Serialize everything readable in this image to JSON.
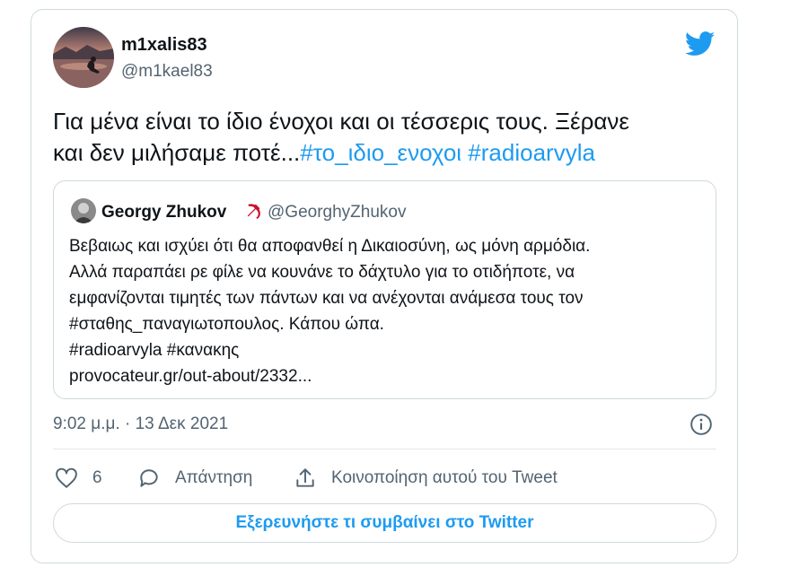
{
  "author": {
    "display_name": "m1xalis83",
    "handle": "@m1kael83"
  },
  "tweet": {
    "text_line1": "Για μένα είναι το ίδιο ένοχοι και οι τέσσερις τους. Ξέρανε",
    "text_line2_plain": "και δεν μιλήσαμε ποτέ...",
    "hashtag_1": "#το_ιδιο_ενοχοι",
    "hashtag_2": "#radioarvyla"
  },
  "quoted_tweet": {
    "display_name": "Georgy Zhukov",
    "handle": "@GeorghyZhukov",
    "lines": [
      "Βεβαιως και ισχύει ότι θα αποφανθεί η Δικαιοσύνη, ως μόνη αρμόδια.",
      "Αλλά παραπάει ρε φίλε να κουνάνε το δάχτυλο για το οτιδήποτε, να",
      "εμφανίζονται τιμητές των πάντων και να ανέχονται ανάμεσα τους τον",
      "#σταθης_παναγιωτοπουλος. Κάπου ώπα.",
      "#radioarvyla #κανακης",
      "provocateur.gr/out-about/2332..."
    ]
  },
  "timestamp": "9:02 μ.μ. · 13 Δεκ 2021",
  "actions": {
    "like_count": "6",
    "reply_label": "Απάντηση",
    "share_label": "Κοινοποίηση αυτού του Tweet"
  },
  "explore_button": "Εξερευνήστε τι συμβαίνει στο Twitter",
  "icons": {
    "brand": "twitter-bird-icon",
    "info": "info-icon",
    "like": "heart-icon",
    "reply": "reply-bubble-icon",
    "share": "share-icon",
    "quote_badge": "hammer-sickle-icon"
  },
  "colors": {
    "accent": "#1d9bf0",
    "text": "#0f1419",
    "secondary_text": "#536471",
    "border": "#cfd9de"
  }
}
